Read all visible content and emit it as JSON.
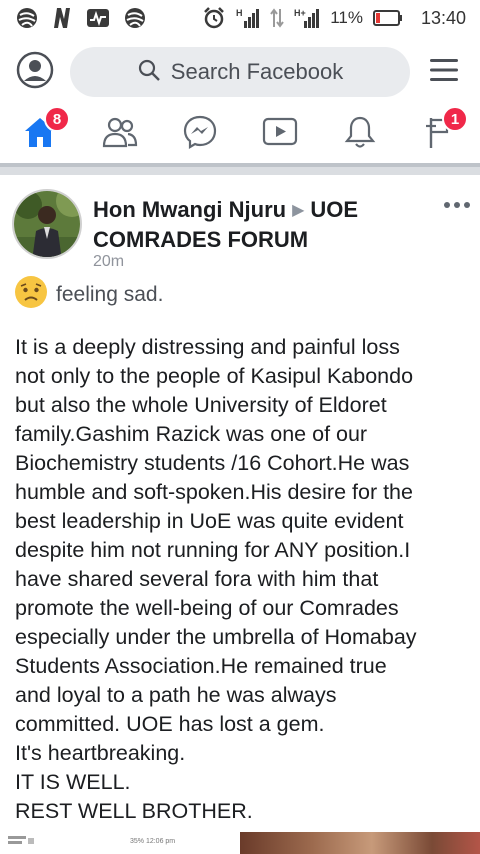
{
  "status_bar": {
    "battery_percent": "11%",
    "time": "13:40",
    "icons": [
      "nba-icon",
      "netflix-icon",
      "activity-icon",
      "nba-icon",
      "alarm-icon",
      "signal-h-icon",
      "data-arrows-icon",
      "signal-h-plus-icon",
      "battery-low-icon"
    ]
  },
  "header": {
    "search_placeholder": "Search Facebook",
    "icons": [
      "profile-icon",
      "search-icon",
      "menu-icon"
    ]
  },
  "nav": {
    "home_badge": "8",
    "flag_badge": "1",
    "accent_color": "#1877f2",
    "badge_color": "#f02849",
    "tabs": [
      "home-icon",
      "friends-icon",
      "messenger-icon",
      "watch-icon",
      "notifications-icon",
      "pages-flag-icon"
    ]
  },
  "post": {
    "author": "Hon Mwangi Njuru",
    "group": "UOE COMRADES FORUM",
    "time": "20m",
    "feeling": "feeling sad.",
    "body": "It is a deeply distressing and painful loss\nnot only to the people of Kasipul Kabondo\nbut also the whole University of Eldoret\nfamily.Gashim Razick was one of our\nBiochemistry students /16 Cohort.He was\nhumble and soft-spoken.His desire for the\nbest leadership in UoE was quite evident\ndespite him not running for ANY position.I\nhave shared several fora with him that\npromote the well-being of our Comrades\nespecially under the umbrella of Homabay\nStudents Association.He remained true\nand loyal to a path he was always\ncommitted. UOE has lost a gem.\nIt's heartbreaking.\nIT IS WELL.\nREST WELL BROTHER."
  },
  "attachment": {
    "status_text": "35% 12:06 pm"
  }
}
